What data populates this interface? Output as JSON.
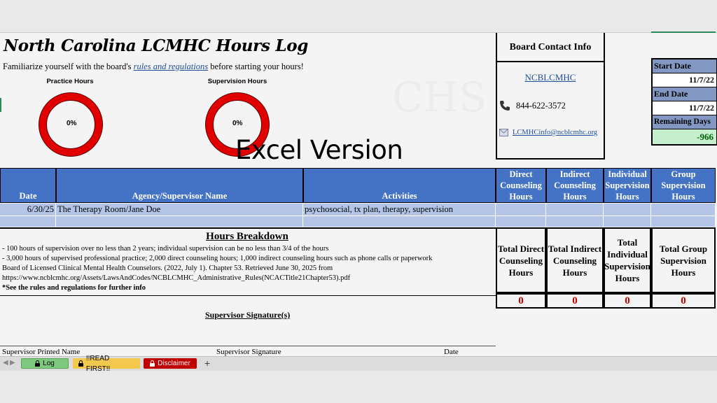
{
  "title": "North Carolina LCMHC Hours Log",
  "intro": {
    "before": "Familiarize yourself with the board's ",
    "link": "rules and regulations",
    "after": " before starting your hours!"
  },
  "gauges": [
    {
      "label": "Practice Hours",
      "percent_text": "0%",
      "value": 0,
      "color": "#e00000"
    },
    {
      "label": "Supervision Hours",
      "percent_text": "0%",
      "value": 0,
      "color": "#e00000"
    }
  ],
  "overlay_text": "Excel Version",
  "watermark": "CHS",
  "board_contact": {
    "heading": "Board Contact Info",
    "link": "NCBLCMHC",
    "phone": "844-622-3572",
    "email": "LCMHCinfo@ncblcmhc.org",
    "phone_icon": "phone-icon",
    "email_icon": "envelope-icon"
  },
  "dates": {
    "start_label": "Start Date",
    "start_value": "11/7/22",
    "end_label": "End Date",
    "end_value": "11/7/22",
    "remaining_label": "Remaining Days",
    "remaining_value": "-966"
  },
  "table": {
    "headers": {
      "date": "Date",
      "agency": "Agency/Supervisor Name",
      "activities": "Activities",
      "direct": "Direct Counseling Hours",
      "indirect": "Indirect Counseling Hours",
      "individual": "Individual Supervision Hours",
      "group": "Group Supervision Hours"
    },
    "rows": [
      {
        "date": "6/30/25",
        "agency": "The Therapy Room/Jane Doe",
        "activities": "psychosocial, tx plan, therapy, supervision",
        "direct": "",
        "indirect": "",
        "individual": "",
        "group": ""
      }
    ]
  },
  "breakdown": {
    "title": "Hours Breakdown",
    "lines": [
      "- 100 hours of supervision over no less than 2 years; individual supervision can be no less than 3/4 of the hours",
      "- 3,000 hours of supervised professional practice; 2,000 direct counseling hours; 1,000 indirect counseling hours such as phone calls or paperwork",
      "Board of Licensed Clinical Mental Health Counselors. (2022, July 1). Chapter 53. Retrieved June 30, 2025 from",
      "https://www.ncblcmhc.org/Assets/LawsAndCodes/NCBLCMHC_Administrative_Rules(NCACTitle21Chapter53).pdf",
      "*See the rules and regulations for further info"
    ]
  },
  "totals": {
    "direct_label": "Total Direct Counseling Hours",
    "indirect_label": "Total Indirect Counseling Hours",
    "individual_label": "Total Individual Supervision Hours",
    "group_label": "Total Group Supervision Hours",
    "direct_value": "0",
    "indirect_value": "0",
    "individual_value": "0",
    "group_value": "0"
  },
  "signature": {
    "title": "Supervisor Signature(s)",
    "printed_name": "Supervisor Printed Name",
    "signature": "Supervisor Signature",
    "date": "Date"
  },
  "sheet_tabs": [
    {
      "label": "Log",
      "color": "#7fc97f",
      "locked": true
    },
    {
      "label": "!!READ FIRST!!",
      "color": "#f2c94c",
      "locked": true
    },
    {
      "label": "Disclaimer",
      "color": "#c00000",
      "locked": true
    }
  ],
  "add_sheet": "+"
}
